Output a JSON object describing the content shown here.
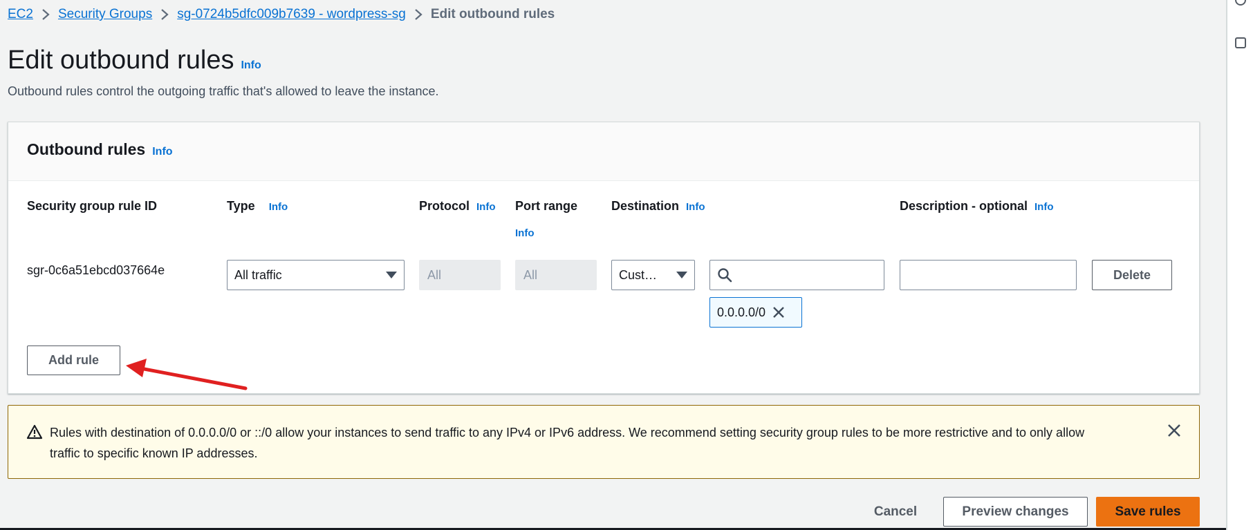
{
  "breadcrumb": {
    "items": [
      "EC2",
      "Security Groups",
      "sg-0724b5dfc009b7639 - wordpress-sg"
    ],
    "current": "Edit outbound rules"
  },
  "page": {
    "title": "Edit outbound rules",
    "info": "Info",
    "description": "Outbound rules control the outgoing traffic that's allowed to leave the instance."
  },
  "panel": {
    "title": "Outbound rules",
    "info": "Info",
    "columns": {
      "rule_id": "Security group rule ID",
      "type": "Type",
      "protocol": "Protocol",
      "port_range": "Port range",
      "destination": "Destination",
      "description": "Description - optional",
      "info": "Info"
    },
    "rule": {
      "id": "sgr-0c6a51ebcd037664e",
      "type": "All traffic",
      "protocol": "All",
      "port_range": "All",
      "destination_type": "Cust…",
      "destination_search": "",
      "destination_token": "0.0.0.0/0",
      "description": "",
      "delete_label": "Delete"
    },
    "add_rule_label": "Add rule"
  },
  "alert": {
    "text": "Rules with destination of 0.0.0.0/0 or ::/0 allow your instances to send traffic to any IPv4 or IPv6 address. We recommend setting security group rules to be more restrictive and to only allow traffic to specific known IP addresses."
  },
  "footer": {
    "cancel": "Cancel",
    "preview": "Preview changes",
    "save": "Save rules"
  },
  "colors": {
    "link": "#0972d3",
    "primary": "#ec7211",
    "warning_bg": "#fffce9",
    "annotation_arrow": "#e02020"
  }
}
